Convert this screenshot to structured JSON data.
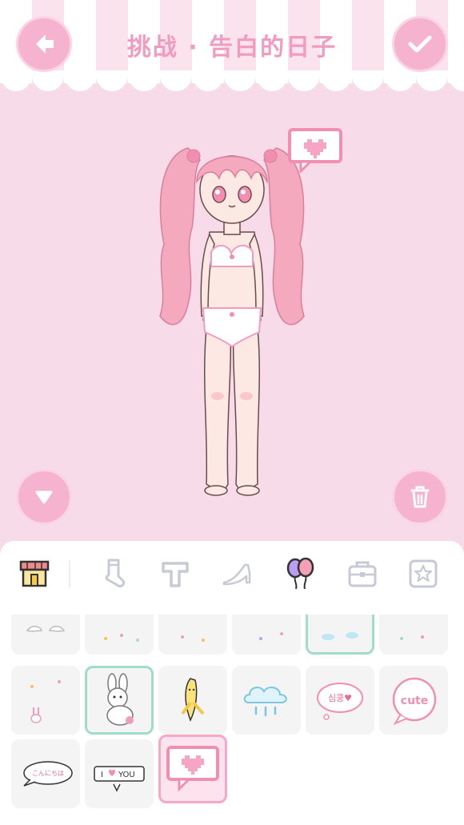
{
  "header": {
    "title": "挑战 · 告白的日子",
    "back_icon": "arrow-left-icon",
    "confirm_icon": "checkmark-icon"
  },
  "stage": {
    "collapse_icon": "triangle-down-icon",
    "delete_icon": "trash-icon",
    "accessory_icon": "pixel-heart-speech-bubble"
  },
  "tabs": [
    {
      "name": "shop",
      "icon": "shop-icon"
    },
    {
      "name": "socks",
      "icon": "sock-icon"
    },
    {
      "name": "tops",
      "icon": "t-shirt-icon"
    },
    {
      "name": "shoes",
      "icon": "high-heel-icon"
    },
    {
      "name": "items",
      "icon": "balloons-icon"
    },
    {
      "name": "bags",
      "icon": "bag-icon"
    },
    {
      "name": "stickers",
      "icon": "star-icon"
    }
  ],
  "items": {
    "korean_bubble_text": "심쿵♥",
    "cute_bubble_text": "cute",
    "japanese_bubble_text": "こんにちは",
    "i_love_you_left": "I",
    "i_love_you_right": "YOU"
  },
  "colors": {
    "background": "#f7dbe9",
    "accent_pink": "#f29bc1",
    "selected_green": "#9fdcc9",
    "selected_pink": "#f7a8c8"
  }
}
